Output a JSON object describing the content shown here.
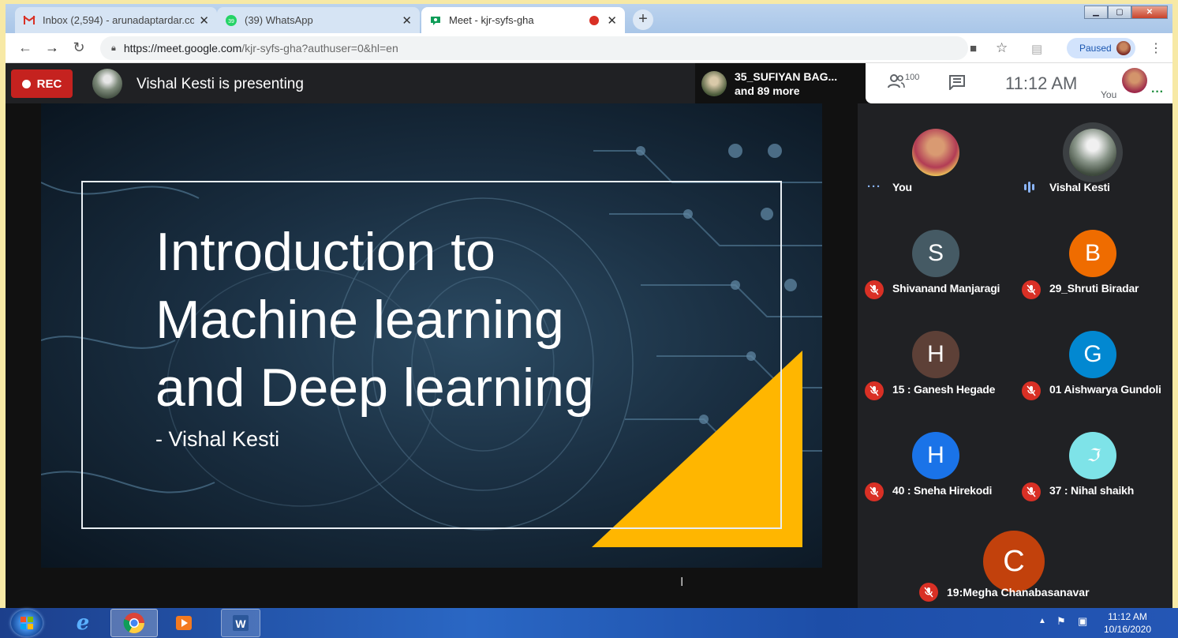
{
  "browser": {
    "tabs": [
      {
        "title": "Inbox (2,594) - arunadaptardar.co",
        "favicon": "gmail-icon",
        "active": false
      },
      {
        "title": "(39) WhatsApp",
        "favicon": "whatsapp-icon",
        "badge": "39",
        "active": false
      },
      {
        "title": "Meet - kjr-syfs-gha",
        "favicon": "meet-icon",
        "active": true
      }
    ],
    "new_tab": "+",
    "url_host": "https://meet.google.com",
    "url_rest": "/kjr-syfs-gha?authuser=0&hl=en",
    "profile_status": "Paused"
  },
  "meet": {
    "rec_label": "REC",
    "presenting_text": "Vishal Kesti is presenting",
    "others_name": "35_SUFIYAN BAG...",
    "others_more": "and 89 more",
    "people_count": "100",
    "clock": "11:12 AM",
    "you_label": "You"
  },
  "slide": {
    "title_line1": "Introduction to",
    "title_line2": "Machine learning",
    "title_line3": "and Deep learning",
    "subtitle": "- Vishal Kesti",
    "accent_color": "#ffb600"
  },
  "participants": [
    {
      "name": "You",
      "initial": "",
      "color": "photo",
      "status": "dots"
    },
    {
      "name": "Vishal Kesti",
      "initial": "",
      "color": "photo",
      "status": "speaking"
    },
    {
      "name": "Shivanand Manjaragi",
      "initial": "S",
      "color": "#455a64",
      "status": "muted"
    },
    {
      "name": "29_Shruti Biradar",
      "initial": "B",
      "color": "#ef6c00",
      "status": "muted"
    },
    {
      "name": "15 : Ganesh Hegade",
      "initial": "H",
      "color": "#5d4037",
      "status": "muted"
    },
    {
      "name": "01 Aishwarya Gundoli",
      "initial": "G",
      "color": "#0288d1",
      "status": "muted"
    },
    {
      "name": "40 : Sneha Hirekodi",
      "initial": "H",
      "color": "#1a73e8",
      "status": "muted"
    },
    {
      "name": "37 : Nihal shaikh",
      "initial": "",
      "color": "#7ee3e8",
      "status": "muted"
    },
    {
      "name": "19:Megha Chanabasanavar",
      "initial": "C",
      "color": "#c2410c",
      "status": "muted"
    }
  ],
  "taskbar": {
    "time": "11:12 AM",
    "date": "10/16/2020"
  }
}
